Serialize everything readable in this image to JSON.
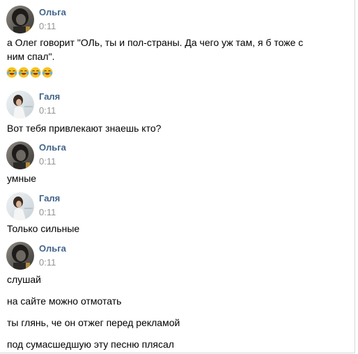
{
  "messages": [
    {
      "author": "Ольга",
      "time": "0:11",
      "lines": [
        "а Олег говорит \"ОЛь, ты и пол-страны. Да чего уж там, я б тоже с ним спал\"."
      ],
      "emoji_icons": [
        "tears-of-joy-icon",
        "tears-of-joy-icon",
        "tears-of-joy-icon",
        "tears-of-joy-icon"
      ]
    },
    {
      "author": "Галя",
      "time": "0:11",
      "lines": [
        "Вот тебя привлекают знаешь кто?"
      ]
    },
    {
      "author": "Ольга",
      "time": "0:11",
      "lines": [
        "умные"
      ]
    },
    {
      "author": "Галя",
      "time": "0:11",
      "lines": [
        "Только сильные"
      ]
    },
    {
      "author": "Ольга",
      "time": "0:11",
      "lines": [
        "слушай",
        "на сайте можно отмотать",
        "ты глянь, че он отжег перед рекламой",
        "под сумасшедшую эту песню плясал"
      ]
    }
  ],
  "colors": {
    "author_name": "#42648b",
    "timestamp": "#939393",
    "message_text": "#000000"
  }
}
